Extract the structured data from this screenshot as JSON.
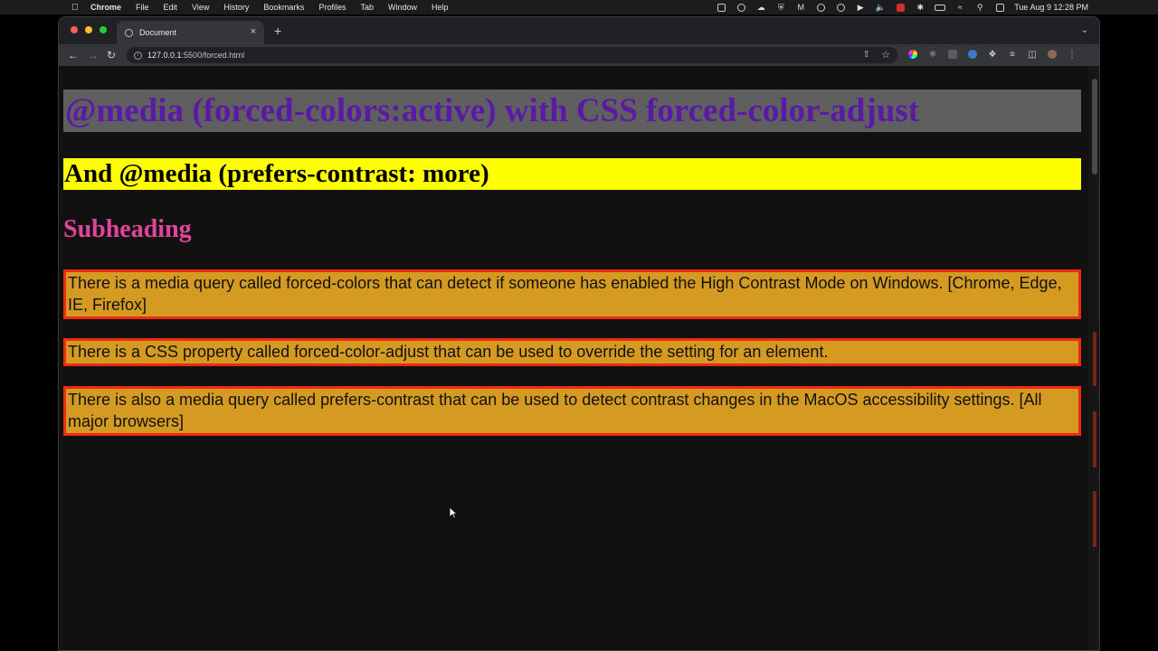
{
  "menubar": {
    "app_name": "Chrome",
    "menus": [
      "File",
      "Edit",
      "View",
      "History",
      "Bookmarks",
      "Profiles",
      "Tab",
      "Window",
      "Help"
    ],
    "clock": "Tue Aug 9  12:28 PM",
    "status_icons": [
      "camera-icon",
      "cast-icon",
      "cloud-icon",
      "shield-icon",
      "mail-icon",
      "globe-icon",
      "info-icon",
      "play-icon",
      "volume-icon",
      "record-icon",
      "bluetooth-icon",
      "battery-icon",
      "wifi-icon",
      "search-icon",
      "control-center-icon"
    ]
  },
  "browser": {
    "tab_title": "Document",
    "url_host": "127.0.0.1",
    "url_path": ":5500/forced.html",
    "extension_icons": [
      "color-wheel-icon",
      "react-icon",
      "grid-extension-icon",
      "circle-extension-icon",
      "puzzle-icon",
      "reading-list-icon",
      "sidebar-icon",
      "profile-avatar-icon",
      "more-menu-icon"
    ]
  },
  "page": {
    "heading1": "@media (forced-colors:active) with CSS forced-color-adjust",
    "heading2": "And @media (prefers-contrast: more)",
    "subheading": "Subheading",
    "paragraphs": [
      "There is a media query called forced-colors that can detect if someone has enabled the High Contrast Mode on Windows. [Chrome, Edge, IE, Firefox]",
      "There is a CSS property called forced-color-adjust that can be used to override the setting for an element.",
      "There is also a media query called prefers-contrast that can be used to detect contrast changes in the MacOS accessibility settings. [All major browsers]"
    ]
  },
  "colors": {
    "heading1_bg": "#5f5f5f",
    "heading1_text": "#5a1aa6",
    "heading2_bg": "#ffff00",
    "subheading_text": "#e0459a",
    "paragraph_bg": "#d49a22",
    "paragraph_border": "#ef2a10",
    "page_bg": "#111111"
  }
}
